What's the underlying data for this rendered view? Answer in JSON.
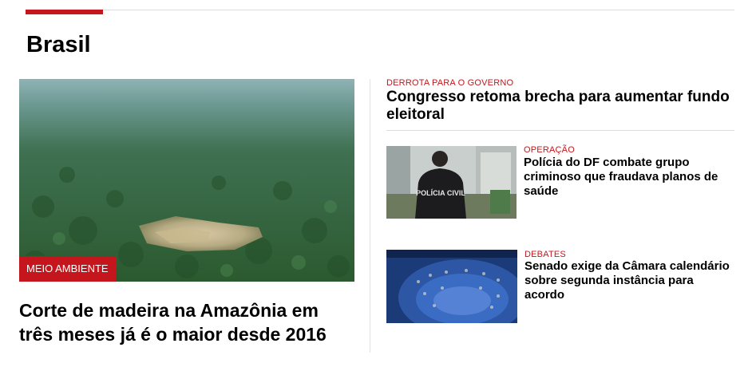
{
  "section": {
    "title": "Brasil"
  },
  "featured": {
    "tag": "MEIO AMBIENTE",
    "headline": "Corte de madeira na Amazônia em três meses já é o maior desde 2016"
  },
  "stories": [
    {
      "kicker": "DERROTA PARA O GOVERNO",
      "title": "Congresso retoma brecha para aumentar fundo eleitoral"
    },
    {
      "kicker": "OPERAÇÃO",
      "title": "Polícia do DF combate grupo criminoso que fraudava planos de saúde",
      "image_text": "POLÍCIA CIVIL"
    },
    {
      "kicker": "DEBATES",
      "title": "Senado exige da Câmara calendário sobre segunda instância para acordo"
    }
  ],
  "colors": {
    "accent": "#c4161c",
    "text": "#000000",
    "divider": "#dddddd"
  }
}
